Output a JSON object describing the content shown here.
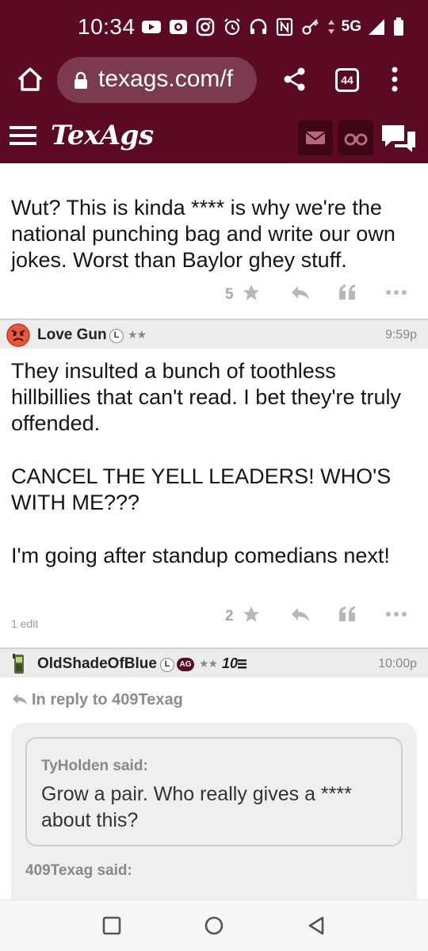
{
  "status_bar": {
    "time": "10:34",
    "network": "5G",
    "left_icons": [
      "youtube-icon",
      "camera-app-icon",
      "instagram-icon"
    ],
    "right_icons": [
      "alarm-icon",
      "headphones-icon",
      "nfc-icon",
      "key-icon",
      "data-arrows-icon",
      "signal-icon",
      "battery-icon"
    ]
  },
  "browser": {
    "url": "texags.com/f",
    "tab_count": "44"
  },
  "site": {
    "logo": "TexAgs"
  },
  "colors": {
    "brand": "#5c0a24",
    "brand_dark": "#3f0616",
    "url_pill": "#7b3a50"
  },
  "posts": [
    {
      "text": "Wut? This is kinda **** is why we're the national punching bag and write our own jokes. Worst than Baylor ghey stuff.",
      "star_count": "5"
    },
    {
      "username": "Love Gun",
      "badge_l": "L",
      "stars": "★★",
      "time": "9:59p",
      "avatar_icon": "angry-face-icon",
      "paragraphs": [
        "They insulted a bunch of toothless hillbillies that can't read. I bet they're truly offended.",
        "CANCEL THE YELL LEADERS! WHO'S WITH ME???",
        "I'm going after standup comedians next!"
      ],
      "edit_note": "1 edit",
      "star_count": "2"
    },
    {
      "username": "OldShadeOfBlue",
      "badge_l": "L",
      "badge_ag": "AG",
      "stars": "★★",
      "rank": "10",
      "time": "10:00p",
      "avatar_icon": "cellphone-icon",
      "reply_to": "In reply to 409Texag",
      "quote": {
        "author": "TyHolden said:",
        "text": "Grow a pair. Who really gives a **** about this?"
      },
      "quote_author_2": "409Texag said:"
    }
  ]
}
